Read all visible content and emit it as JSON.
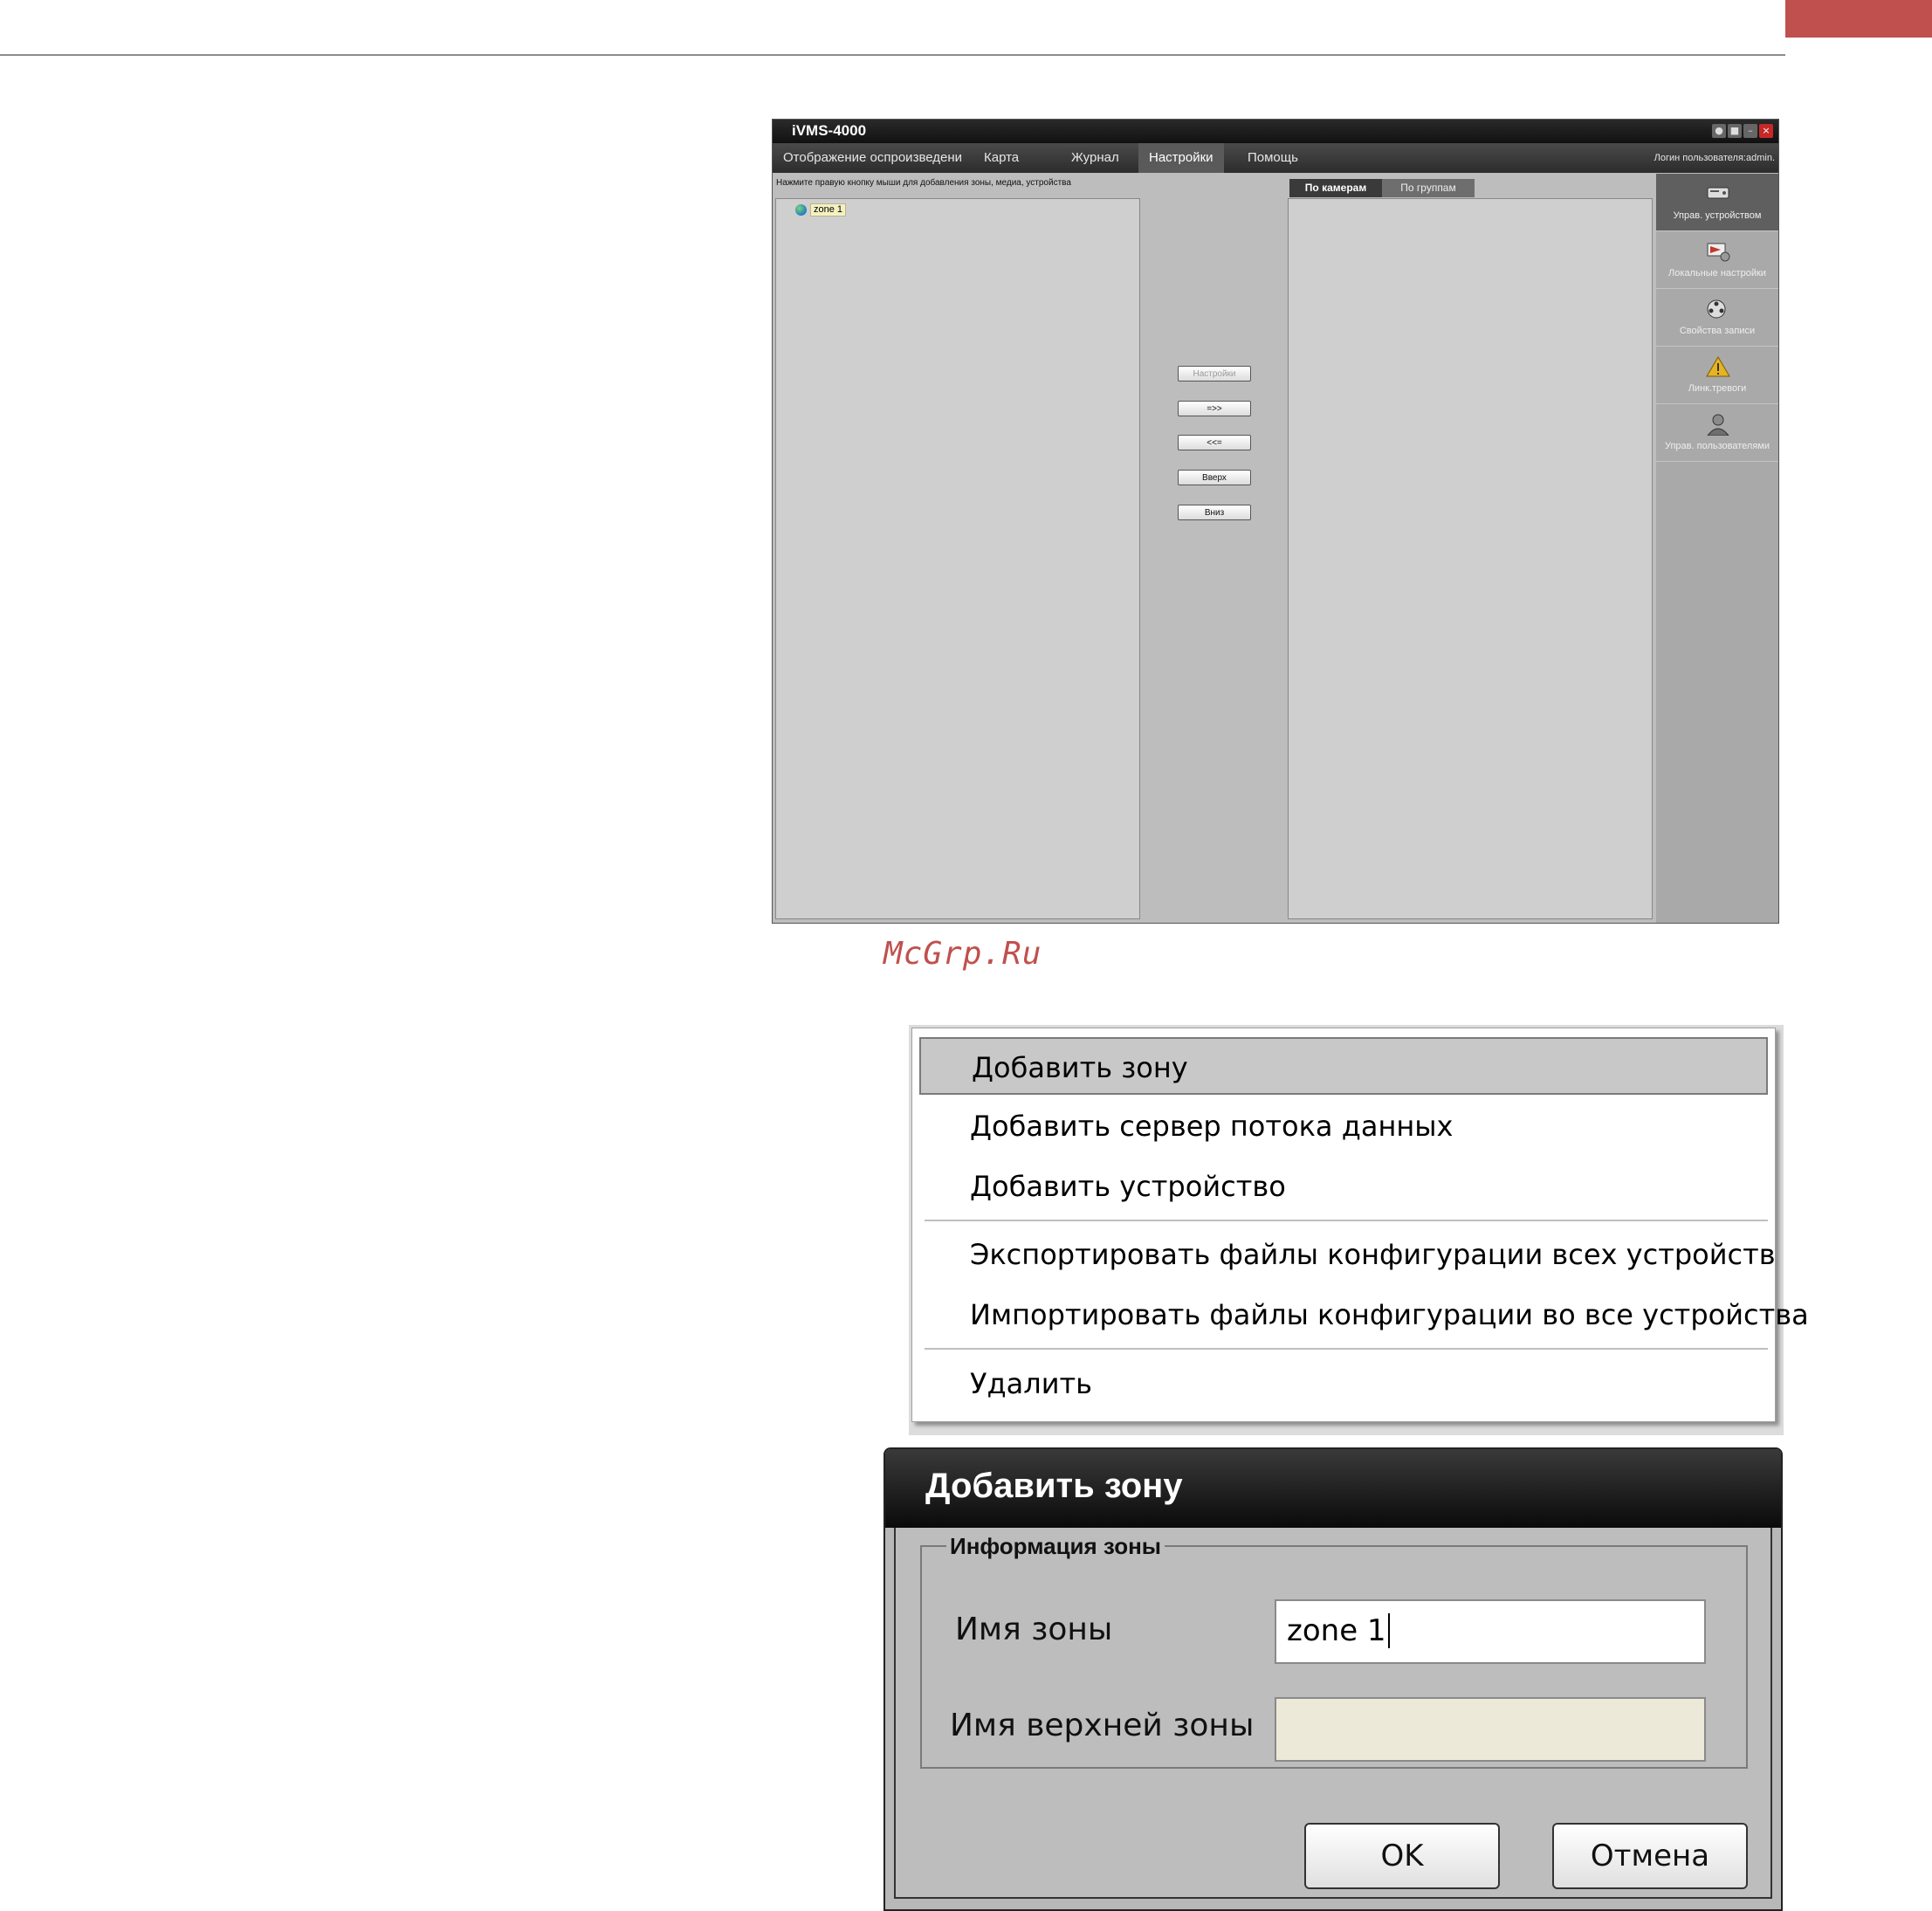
{
  "colors": {
    "accent": "#c0504d"
  },
  "watermark": "McGrp.Ru",
  "ivms": {
    "title": "iVMS-4000",
    "menu": [
      "Отображение оспроизведени",
      "Карта",
      "Журнал",
      "Настройки",
      "Помощь"
    ],
    "active_menu": "Настройки",
    "login_info": "Логин пользователя:admin.",
    "hint": "Нажмите правую кнопку мыши для добавления зоны, медиа, устройства",
    "tree": {
      "zone_label": "zone 1"
    },
    "mid_buttons": [
      "Настройки",
      "=>>",
      "<<=",
      "Вверх",
      "Вниз"
    ],
    "tabs": [
      "По камерам",
      "По группам"
    ],
    "side_nav": [
      {
        "label": "Управ. устройством",
        "icon": "device-management-icon"
      },
      {
        "label": "Локальные настройки",
        "icon": "local-settings-icon"
      },
      {
        "label": "Свойства записи",
        "icon": "record-properties-icon"
      },
      {
        "label": "Линк.тревоги",
        "icon": "alarm-link-icon"
      },
      {
        "label": "Управ. пользователями",
        "icon": "user-management-icon"
      }
    ]
  },
  "context_menu": {
    "items": [
      "Добавить зону",
      "Добавить сервер потока данных",
      "Добавить устройство",
      "Экспортировать файлы конфигурации всех устройств",
      "Импортировать файлы конфигурации во все устройства",
      "Удалить"
    ]
  },
  "dialog": {
    "title": "Добавить зону",
    "group_label": "Информация зоны",
    "zone_name_label": "Имя зоны",
    "zone_name_value": "zone 1",
    "parent_zone_label": "Имя верхней зоны",
    "parent_zone_value": "",
    "ok_label": "OK",
    "cancel_label": "Отмена"
  }
}
